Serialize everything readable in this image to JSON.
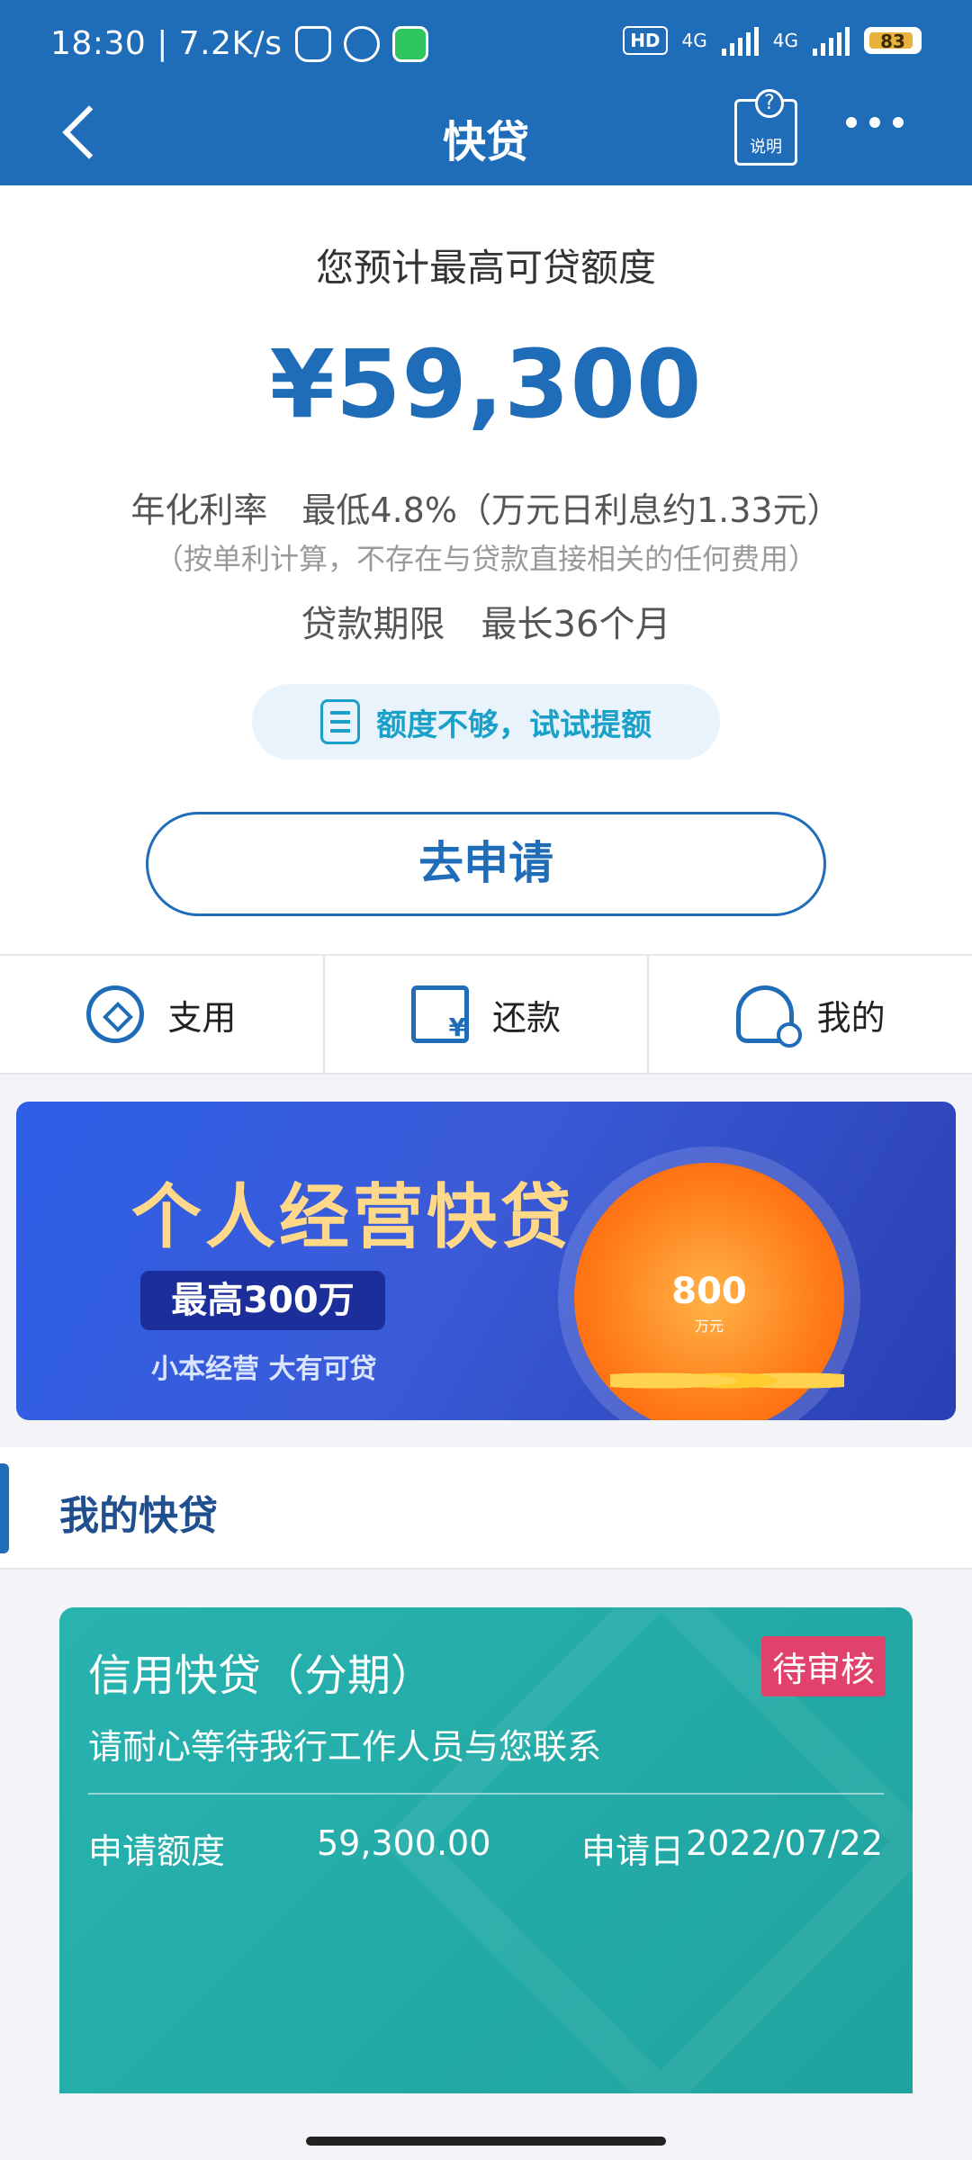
{
  "status_bar": {
    "time_speed": "18:30 | 7.2K/s",
    "hd": "HD",
    "net1": "4G",
    "net2": "4G",
    "battery": "83"
  },
  "header": {
    "title": "快贷",
    "help_label": "说明",
    "help_q": "?"
  },
  "main": {
    "quota_label": "您预计最高可贷额度",
    "amount": "¥59,300",
    "rate": "年化利率　最低4.8%（万元日利息约1.33元）",
    "rate_note": "（按单利计算，不存在与贷款直接相关的任何费用）",
    "term": "贷款期限　最长36个月",
    "raise_label": "额度不够，试试提额",
    "apply_label": "去申请"
  },
  "actions": [
    {
      "label": "支用",
      "icon": "withdraw-icon"
    },
    {
      "label": "还款",
      "icon": "repay-icon"
    },
    {
      "label": "我的",
      "icon": "user-icon"
    }
  ],
  "banner": {
    "title": "个人经营快贷",
    "pill": "最高300万",
    "subtitle": "小本经营 大有可贷",
    "gauge_value": "800",
    "gauge_unit": "万元"
  },
  "my_loans": {
    "section_title": "我的快贷",
    "card": {
      "title": "信用快贷（分期）",
      "status": "待审核",
      "message": "请耐心等待我行工作人员与您联系",
      "amount_label": "申请额度",
      "amount_value": "59,300.00",
      "date_label": "申请日",
      "date_value": "2022/07/22"
    }
  },
  "colors": {
    "primary": "#1f6cb8",
    "accent_teal": "#20a39f",
    "badge": "#e0426b"
  }
}
